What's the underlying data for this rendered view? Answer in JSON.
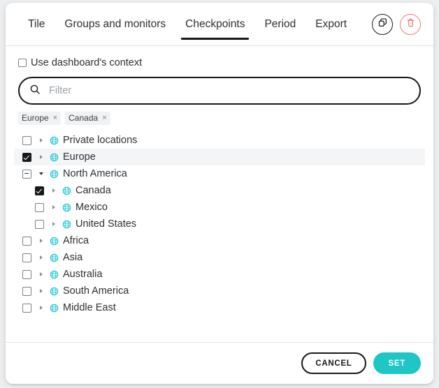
{
  "header": {
    "tabs": [
      {
        "label": "Tile",
        "active": false
      },
      {
        "label": "Groups and monitors",
        "active": false
      },
      {
        "label": "Checkpoints",
        "active": true
      },
      {
        "label": "Period",
        "active": false
      },
      {
        "label": "Export",
        "active": false
      }
    ],
    "actions": [
      {
        "name": "duplicate-button",
        "icon": "copy-icon",
        "color": "#16181a"
      },
      {
        "name": "delete-button",
        "icon": "trash-icon",
        "color": "#f07a7a"
      }
    ]
  },
  "context": {
    "checkbox_label": "Use dashboard's context",
    "checked": false
  },
  "search": {
    "placeholder": "Filter",
    "value": "",
    "icon": "search-icon"
  },
  "chips": [
    {
      "label": "Europe",
      "remove": "×"
    },
    {
      "label": "Canada",
      "remove": "×"
    }
  ],
  "tree": {
    "items": [
      {
        "label": "Private locations",
        "state": "unchecked",
        "expanded": false,
        "indent": 0,
        "highlight": false,
        "icon": "globe-icon"
      },
      {
        "label": "Europe",
        "state": "checked",
        "expanded": false,
        "indent": 0,
        "highlight": true,
        "icon": "globe-icon"
      },
      {
        "label": "North America",
        "state": "indeterminate",
        "expanded": true,
        "indent": 0,
        "highlight": false,
        "icon": "globe-icon"
      },
      {
        "label": "Canada",
        "state": "checked",
        "expanded": false,
        "indent": 1,
        "highlight": false,
        "icon": "globe-icon"
      },
      {
        "label": "Mexico",
        "state": "unchecked",
        "expanded": false,
        "indent": 1,
        "highlight": false,
        "icon": "globe-icon"
      },
      {
        "label": "United States",
        "state": "unchecked",
        "expanded": false,
        "indent": 1,
        "highlight": false,
        "icon": "globe-icon"
      },
      {
        "label": "Africa",
        "state": "unchecked",
        "expanded": false,
        "indent": 0,
        "highlight": false,
        "icon": "globe-icon"
      },
      {
        "label": "Asia",
        "state": "unchecked",
        "expanded": false,
        "indent": 0,
        "highlight": false,
        "icon": "globe-icon"
      },
      {
        "label": "Australia",
        "state": "unchecked",
        "expanded": false,
        "indent": 0,
        "highlight": false,
        "icon": "globe-icon"
      },
      {
        "label": "South America",
        "state": "unchecked",
        "expanded": false,
        "indent": 0,
        "highlight": false,
        "icon": "globe-icon"
      },
      {
        "label": "Middle East",
        "state": "unchecked",
        "expanded": false,
        "indent": 0,
        "highlight": false,
        "icon": "globe-icon"
      }
    ]
  },
  "footer": {
    "cancel_label": "CANCEL",
    "set_label": "SET"
  },
  "colors": {
    "accent_teal": "#1fc6c6",
    "globe_teal": "#2ec9d4",
    "danger_red": "#f07a7a",
    "ink": "#16181a",
    "row_highlight": "#f4f5f6"
  }
}
